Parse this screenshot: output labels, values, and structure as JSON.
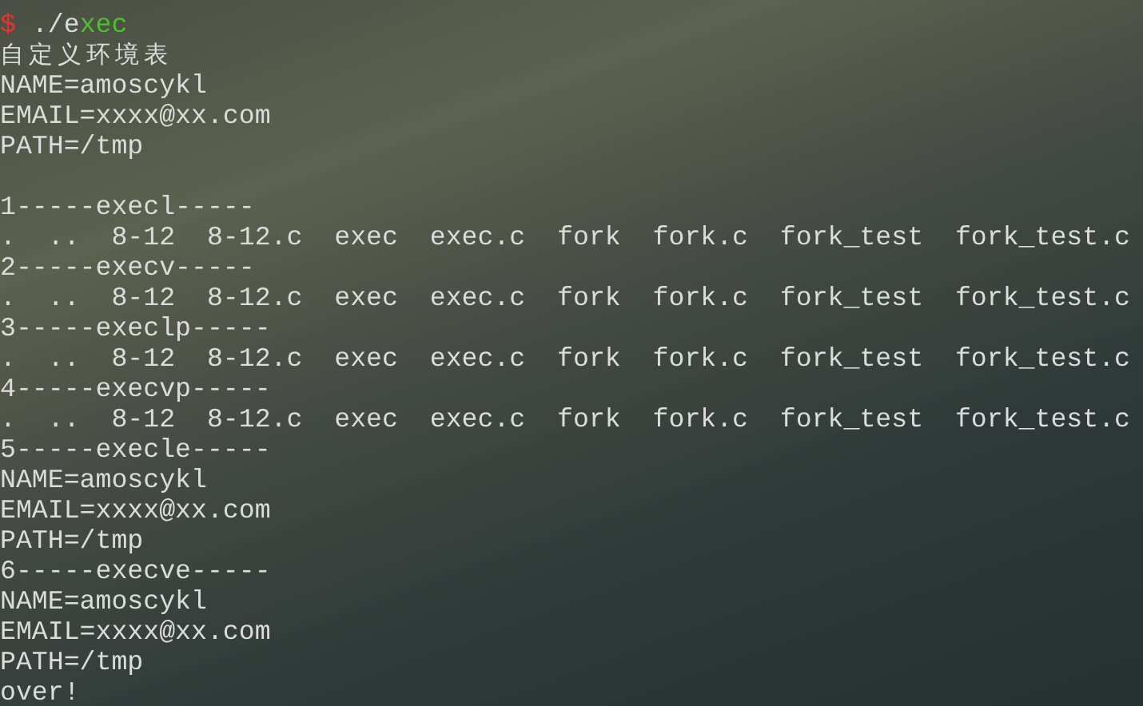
{
  "terminal": {
    "lines": [
      {
        "kind": "prompt",
        "symbol": "$",
        "typed": "./e",
        "suggestion": "xec"
      },
      {
        "kind": "output",
        "text": "自定义环境表"
      },
      {
        "kind": "output",
        "text": "NAME=amoscykl"
      },
      {
        "kind": "output",
        "text": "EMAIL=xxxx@xx.com"
      },
      {
        "kind": "output",
        "text": "PATH=/tmp"
      },
      {
        "kind": "blank"
      },
      {
        "kind": "output",
        "text": "1-----execl-----"
      },
      {
        "kind": "output",
        "text": ".  ..  8-12  8-12.c  exec  exec.c  fork  fork.c  fork_test  fork_test.c"
      },
      {
        "kind": "output",
        "text": "2-----execv-----"
      },
      {
        "kind": "output",
        "text": ".  ..  8-12  8-12.c  exec  exec.c  fork  fork.c  fork_test  fork_test.c"
      },
      {
        "kind": "output",
        "text": "3-----execlp-----"
      },
      {
        "kind": "output",
        "text": ".  ..  8-12  8-12.c  exec  exec.c  fork  fork.c  fork_test  fork_test.c"
      },
      {
        "kind": "output",
        "text": "4-----execvp-----"
      },
      {
        "kind": "output",
        "text": ".  ..  8-12  8-12.c  exec  exec.c  fork  fork.c  fork_test  fork_test.c"
      },
      {
        "kind": "output",
        "text": "5-----execle-----"
      },
      {
        "kind": "output",
        "text": "NAME=amoscykl"
      },
      {
        "kind": "output",
        "text": "EMAIL=xxxx@xx.com"
      },
      {
        "kind": "output",
        "text": "PATH=/tmp"
      },
      {
        "kind": "output",
        "text": "6-----execve-----"
      },
      {
        "kind": "output",
        "text": "NAME=amoscykl"
      },
      {
        "kind": "output",
        "text": "EMAIL=xxxx@xx.com"
      },
      {
        "kind": "output",
        "text": "PATH=/tmp"
      },
      {
        "kind": "output",
        "text": "over!"
      }
    ]
  }
}
